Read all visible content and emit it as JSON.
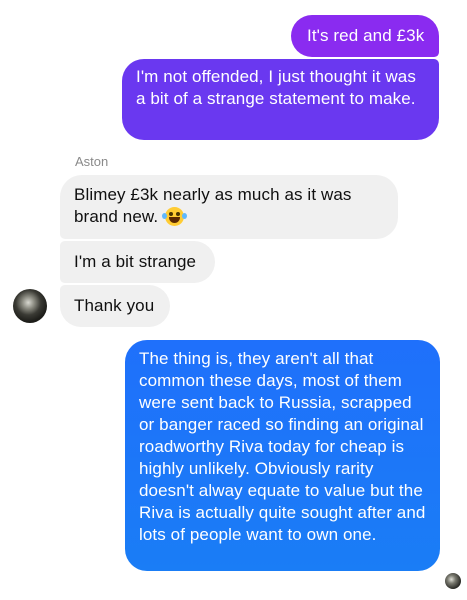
{
  "colors": {
    "outgoing_purple": "#8a2bf0",
    "outgoing_violet": "#6a38f0",
    "outgoing_blue": "#1f70fb",
    "incoming_gray": "#f0f0f0",
    "sender_label": "#8a8a8a"
  },
  "conversation": {
    "messages": [
      {
        "direction": "outgoing",
        "text": "It's red and £3k"
      },
      {
        "direction": "outgoing",
        "text": "I'm not offended, I just thought it was a bit of a strange statement to make."
      },
      {
        "direction": "incoming",
        "sender": "Aston",
        "text": "Blimey £3k nearly as much as it was brand new.",
        "emoji": "laughing-crying-face"
      },
      {
        "direction": "incoming",
        "text": "I'm a bit strange"
      },
      {
        "direction": "incoming",
        "text": "Thank you"
      },
      {
        "direction": "outgoing",
        "text": "The thing is, they aren't all that common these days, most of them were sent back to Russia, scrapped or banger raced so finding an original roadworthy Riva today for cheap is highly unlikely. Obviously rarity doesn't alway equate to value but the Riva is actually quite sought after and lots of people want to own one."
      }
    ],
    "sender_name": "Aston",
    "avatar_icon": "contact-avatar",
    "read_receipt_icon": "read-receipt-avatar"
  }
}
